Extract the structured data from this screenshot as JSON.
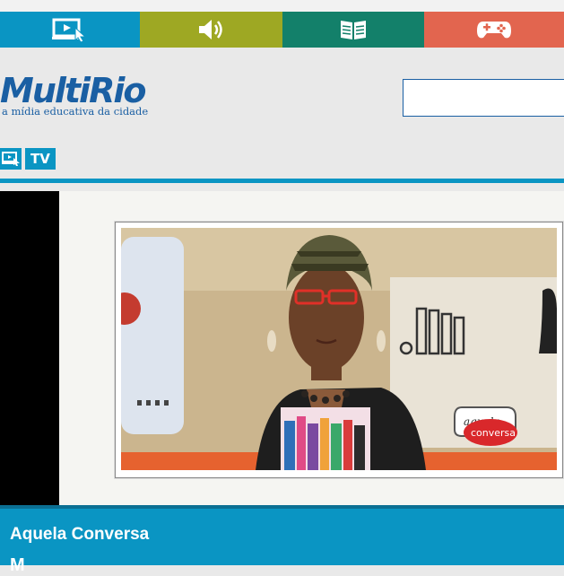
{
  "nav": {
    "categories": [
      {
        "icon": "video-click-icon",
        "color": "#0a95c3"
      },
      {
        "icon": "speaker-icon",
        "color": "#9ea823"
      },
      {
        "icon": "book-icon",
        "color": "#13806a"
      },
      {
        "icon": "gamepad-icon",
        "color": "#e2654f"
      }
    ]
  },
  "header": {
    "logo_multi": "Multi",
    "logo_rio": "Rio",
    "tagline": "a mídia educativa da cidade",
    "search_placeholder": ""
  },
  "breadcrumb": {
    "tv_label": "TV"
  },
  "video": {
    "badge_line1": "aquela",
    "badge_line2": "conversa"
  },
  "caption": {
    "title": "Aquela Conversa",
    "subtitle_partial": "M"
  },
  "colors": {
    "brand_blue": "#1a5fa3",
    "accent_cyan": "#0a95c3"
  }
}
